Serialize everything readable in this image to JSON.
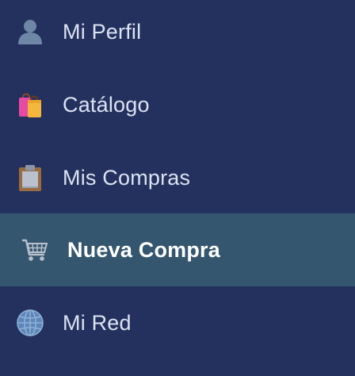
{
  "sidebar": {
    "items": [
      {
        "label": "Mi Perfil",
        "icon": "user-icon",
        "active": false
      },
      {
        "label": "Catálogo",
        "icon": "shopping-bags-icon",
        "active": false
      },
      {
        "label": "Mis Compras",
        "icon": "clipboard-icon",
        "active": false
      },
      {
        "label": "Nueva Compra",
        "icon": "shopping-cart-icon",
        "active": true
      },
      {
        "label": "Mi Red",
        "icon": "globe-icon",
        "active": false
      }
    ]
  },
  "colors": {
    "background": "#24315e",
    "active_background": "#34566f",
    "text": "#dbe2f1",
    "active_text": "#ffffff"
  }
}
